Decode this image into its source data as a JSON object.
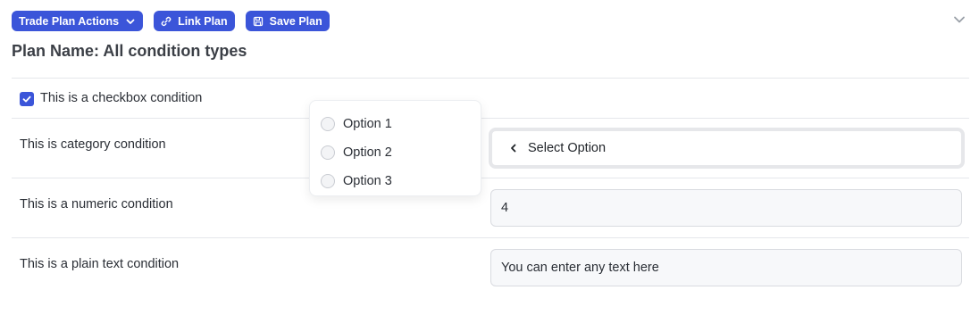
{
  "toolbar": {
    "actions_label": "Trade Plan Actions",
    "link_label": "Link Plan",
    "save_label": "Save Plan"
  },
  "plan": {
    "name": "Plan Name: All condition types"
  },
  "conditions": {
    "checkbox": {
      "label": "This is a checkbox condition",
      "checked": true
    },
    "category": {
      "label": "This is category condition",
      "select_value": "Select Option"
    },
    "numeric": {
      "label": "This is a numeric condition",
      "value": "4"
    },
    "plain_text": {
      "label": "This is a plain text condition",
      "value": "You can enter any text here"
    }
  },
  "dropdown": {
    "options": [
      "Option 1",
      "Option 2",
      "Option 3"
    ]
  },
  "colors": {
    "accent": "#3b55d9",
    "border": "#e5e7eb"
  }
}
